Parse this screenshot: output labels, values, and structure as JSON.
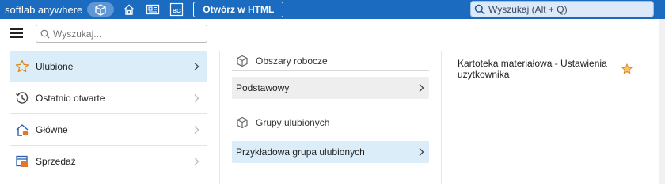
{
  "topbar": {
    "brand": "softlab anywhere",
    "html_button": "Otwórz w HTML",
    "search_placeholder": "Wyszukaj (Alt + Q)",
    "bc_label": "BC"
  },
  "menu": {
    "search_placeholder": "Wyszukaj...",
    "items": [
      {
        "label": "Ulubione",
        "icon": "star-icon",
        "active": true
      },
      {
        "label": "Ostatnio otwarte",
        "icon": "history-icon",
        "active": false
      },
      {
        "label": "Główne",
        "icon": "home-icon",
        "active": false
      },
      {
        "label": "Sprzedaż",
        "icon": "sales-icon",
        "active": false
      }
    ]
  },
  "middle": {
    "workspaces_header": "Obszary robocze",
    "workspace_item": "Podstawowy",
    "groups_header": "Grupy ulubionych",
    "group_item": "Przykładowa grupa ulubionych"
  },
  "favorites": {
    "item": "Kartoteka materiałowa - Ustawienia użytkownika"
  },
  "colors": {
    "topbar": "#1b6cc0",
    "active_bg": "#dbedf9",
    "star": "#f0a030"
  }
}
